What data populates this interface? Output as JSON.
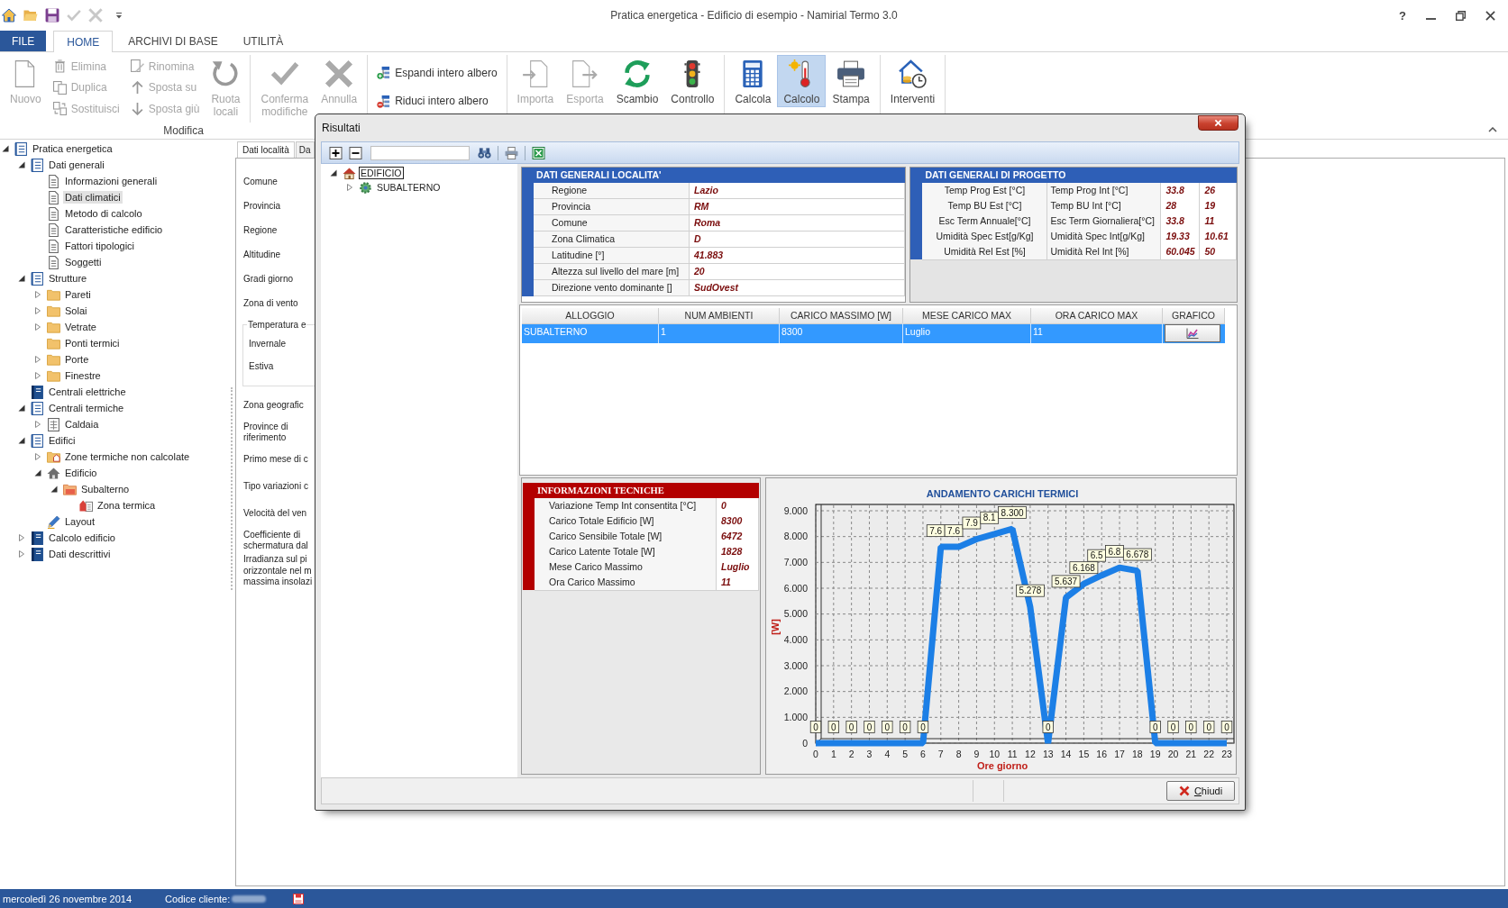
{
  "window": {
    "title": "Pratica energetica - Edificio di esempio - Namirial Termo 3.0",
    "help": "?"
  },
  "ribbon": {
    "tabs": [
      {
        "label": "FILE",
        "kind": "file",
        "selected": false
      },
      {
        "label": "HOME",
        "kind": "tab",
        "selected": true
      },
      {
        "label": "ARCHIVI DI BASE",
        "kind": "tab",
        "selected": false
      },
      {
        "label": "UTILITÀ",
        "kind": "tab",
        "selected": false
      }
    ],
    "groups": [
      {
        "label": "Modifica",
        "sections": [
          [
            {
              "kind": "large",
              "label": "Nuovo",
              "disabled": true,
              "pressed": false
            },
            {
              "kind": "stack",
              "items": [
                {
                  "label": "Elimina",
                  "disabled": true
                },
                {
                  "label": "Duplica",
                  "disabled": true
                },
                {
                  "label": "Sostituisci",
                  "disabled": true
                }
              ]
            },
            {
              "kind": "stack",
              "items": [
                {
                  "label": "Rinomina",
                  "disabled": true
                },
                {
                  "label": "Sposta su",
                  "disabled": true
                },
                {
                  "label": "Sposta giù",
                  "disabled": true
                }
              ]
            },
            {
              "kind": "large",
              "label": "Ruota locali",
              "disabled": true,
              "pressed": false
            }
          ],
          [
            {
              "kind": "large",
              "label": "Conferma modifiche",
              "disabled": true,
              "pressed": false
            },
            {
              "kind": "large",
              "label": "Annulla",
              "disabled": true,
              "pressed": false
            }
          ]
        ]
      },
      {
        "sections": [
          [
            {
              "kind": "stack",
              "items": [
                {
                  "label": "Espandi intero albero",
                  "disabled": false
                },
                {
                  "label": "Riduci intero albero",
                  "disabled": false
                }
              ]
            }
          ]
        ]
      },
      {
        "sections": [
          [
            {
              "kind": "large",
              "label": "Importa",
              "disabled": true,
              "pressed": false
            },
            {
              "kind": "large",
              "label": "Esporta",
              "disabled": true,
              "pressed": false
            },
            {
              "kind": "large",
              "label": "Scambio",
              "disabled": false,
              "pressed": false
            },
            {
              "kind": "large",
              "label": "Controllo",
              "disabled": false,
              "pressed": false
            }
          ]
        ]
      },
      {
        "sections": [
          [
            {
              "kind": "large",
              "label": "Calcola",
              "disabled": false,
              "pressed": false
            },
            {
              "kind": "large",
              "label": "Calcolo",
              "disabled": false,
              "pressed": true
            },
            {
              "kind": "large",
              "label": "Stampa",
              "disabled": false,
              "pressed": false
            }
          ]
        ]
      },
      {
        "sections": [
          [
            {
              "kind": "large",
              "label": "Interventi",
              "disabled": false,
              "pressed": false
            }
          ]
        ]
      }
    ]
  },
  "tree": [
    {
      "label": "Pratica energetica",
      "kind": "list",
      "expanded": true,
      "selected": false,
      "children": [
        {
          "label": "Dati generali",
          "kind": "list",
          "expanded": true,
          "selected": false,
          "children": [
            {
              "label": "Informazioni generali",
              "kind": "page",
              "selected": false
            },
            {
              "label": "Dati climatici",
              "kind": "page",
              "selected": true
            },
            {
              "label": "Metodo di calcolo",
              "kind": "page",
              "selected": false
            },
            {
              "label": "Caratteristiche edificio",
              "kind": "page",
              "selected": false
            },
            {
              "label": "Fattori tipologici",
              "kind": "page",
              "selected": false
            },
            {
              "label": "Soggetti",
              "kind": "page",
              "selected": false
            }
          ]
        },
        {
          "label": "Strutture",
          "kind": "list",
          "expanded": true,
          "selected": false,
          "children": [
            {
              "label": "Pareti",
              "kind": "folder",
              "expanded": false,
              "selected": false
            },
            {
              "label": "Solai",
              "kind": "folder",
              "expanded": false,
              "selected": false
            },
            {
              "label": "Vetrate",
              "kind": "folder",
              "expanded": false,
              "selected": false
            },
            {
              "label": "Ponti termici",
              "kind": "folder",
              "selected": false
            },
            {
              "label": "Porte",
              "kind": "folder",
              "expanded": false,
              "selected": false
            },
            {
              "label": "Finestre",
              "kind": "folder",
              "expanded": false,
              "selected": false
            }
          ]
        },
        {
          "label": "Centrali elettriche",
          "kind": "book",
          "selected": false
        },
        {
          "label": "Centrali termiche",
          "kind": "list",
          "expanded": true,
          "selected": false,
          "children": [
            {
              "label": "Caldaia",
              "kind": "unit",
              "expanded": false,
              "selected": false
            }
          ]
        },
        {
          "label": "Edifici",
          "kind": "list",
          "expanded": true,
          "selected": false,
          "children": [
            {
              "label": "Zone termiche non calcolate",
              "kind": "zonefolder",
              "expanded": false,
              "selected": false
            },
            {
              "label": "Edificio",
              "kind": "house",
              "expanded": true,
              "selected": false,
              "children": [
                {
                  "label": "Subalterno",
                  "kind": "subfolder",
                  "expanded": true,
                  "selected": false,
                  "children": [
                    {
                      "label": "Zona termica",
                      "kind": "zone",
                      "selected": false
                    }
                  ]
                }
              ]
            },
            {
              "label": "Layout",
              "kind": "pencil",
              "selected": false
            }
          ]
        },
        {
          "label": "Calcolo edificio",
          "kind": "book",
          "expanded": false,
          "selected": false
        },
        {
          "label": "Dati descrittivi",
          "kind": "book",
          "expanded": false,
          "selected": false
        }
      ]
    }
  ],
  "detail_panel": {
    "tabs": [
      {
        "label": "Dati località",
        "selected": true
      },
      {
        "label": "Da",
        "selected": false
      }
    ],
    "fields_top": [
      "Comune",
      "Provincia",
      "Regione",
      "Altitudine",
      "Gradi giorno",
      "Zona di vento"
    ],
    "group_box": {
      "title": "Temperatura e",
      "fields": [
        "Invernale",
        "Estiva"
      ]
    },
    "fields_bottom": [
      [
        "Zona geografic"
      ],
      [
        "Province di",
        "riferimento"
      ],
      [
        "Primo mese di c"
      ],
      [
        "Tipo variazioni c"
      ],
      [
        "Velocità del ven"
      ],
      [
        "Coefficiente di",
        "schermatura dal"
      ],
      [
        "Irradianza sul pi",
        "orizzontale nel m",
        "massima insolazi"
      ]
    ]
  },
  "dialog": {
    "title": "Risultati",
    "tree": [
      {
        "label": "EDIFICIO",
        "kind": "home",
        "expanded": true,
        "selected": true,
        "children": [
          {
            "label": "SUBALTERNO",
            "kind": "gear",
            "expanded": false,
            "selected": false
          }
        ]
      }
    ],
    "location": {
      "title": "DATI GENERALI LOCALITA'",
      "rows": [
        {
          "label": "Regione",
          "value": "Lazio"
        },
        {
          "label": "Provincia",
          "value": "RM"
        },
        {
          "label": "Comune",
          "value": "Roma"
        },
        {
          "label": "Zona Climatica",
          "value": "D"
        },
        {
          "label": "Latitudine [°]",
          "value": "41.883"
        },
        {
          "label": "Altezza sul livello del mare [m]",
          "value": "20"
        },
        {
          "label": "Direzione vento dominante []",
          "value": "SudOvest"
        }
      ]
    },
    "project": {
      "title": "DATI GENERALI DI PROGETTO",
      "rows": [
        {
          "label_1": "Temp Prog Est [°C]",
          "label_2": "Temp Prog Int [°C]",
          "value_1": "33.8",
          "value_2": "26"
        },
        {
          "label_1": "Temp BU Est [°C]",
          "label_2": "Temp BU Int [°C]",
          "value_1": "28",
          "value_2": "19"
        },
        {
          "label_1": "Esc Term Annuale[°C]",
          "label_2": "Esc Term Giornaliera[°C]",
          "value_1": "33.8",
          "value_2": "11"
        },
        {
          "label_1": "Umidità Spec Est[g/Kg]",
          "label_2": "Umidità Spec Int[g/Kg]",
          "value_1": "19.33",
          "value_2": "10.61"
        },
        {
          "label_1": "Umidità Rel Est [%]",
          "label_2": "Umidità Rel Int [%]",
          "value_1": "60.045",
          "value_2": "50"
        }
      ]
    },
    "results": {
      "columns": [
        "ALLOGGIO",
        "NUM AMBIENTI",
        "CARICO MASSIMO [W]",
        "MESE CARICO MAX",
        "ORA CARICO MAX",
        "GRAFICO"
      ],
      "rows": [
        {
          "selected": true,
          "cells": [
            "SUBALTERNO",
            "1",
            "8300",
            "Luglio",
            "11"
          ]
        }
      ]
    },
    "technical_info": {
      "title": "INFORMAZIONI TECNICHE",
      "rows": [
        {
          "label": "Variazione Temp Int consentita [°C]",
          "value": "0"
        },
        {
          "label": "Carico Totale Edificio [W]",
          "value": "8300"
        },
        {
          "label": "Carico Sensibile Totale [W]",
          "value": "6472"
        },
        {
          "label": "Carico Latente Totale [W]",
          "value": "1828"
        },
        {
          "label": "Mese Carico Massimo",
          "value": "Luglio"
        },
        {
          "label": "Ora Carico Massimo",
          "value": "11"
        }
      ]
    },
    "chart": {
      "chart_data": {
        "type": "line",
        "title": "ANDAMENTO CARICHI TERMICI",
        "xlabel": "Ore giorno",
        "ylabel": "[W]",
        "x": [
          0,
          1,
          2,
          3,
          4,
          5,
          6,
          7,
          8,
          9,
          10,
          11,
          12,
          13,
          14,
          15,
          16,
          17,
          18,
          19,
          20,
          21,
          22,
          23
        ],
        "values": [
          0,
          0,
          0,
          0,
          0,
          0,
          0,
          7.6,
          7.6,
          7.9,
          8.1,
          8.3,
          5.278,
          0,
          5.637,
          6.168,
          6.5,
          6.8,
          6.678,
          0,
          0,
          0,
          0,
          0
        ],
        "xlim": [
          0,
          23
        ],
        "ylim": [
          0,
          9
        ],
        "xticks": [
          0,
          1,
          2,
          3,
          4,
          5,
          6,
          7,
          8,
          9,
          10,
          11,
          12,
          13,
          14,
          15,
          16,
          17,
          18,
          19,
          20,
          21,
          22,
          23
        ],
        "yticks": [
          {
            "value": 0,
            "label": "0"
          },
          {
            "value": 1,
            "label": "1.000"
          },
          {
            "value": 2,
            "label": "2.000"
          },
          {
            "value": 3,
            "label": "3.000"
          },
          {
            "value": 4,
            "label": "4.000"
          },
          {
            "value": 5,
            "label": "5.000"
          },
          {
            "value": 6,
            "label": "6.000"
          },
          {
            "value": 7,
            "label": "7.000"
          },
          {
            "value": 8,
            "label": "8.000"
          },
          {
            "value": 9,
            "label": "9.000"
          }
        ],
        "grid": true,
        "value_labels": [
          "0",
          "0",
          "0",
          "0",
          "0",
          "0",
          "0",
          "7.6",
          "7.6",
          "7.9",
          "8.1",
          "8.300",
          "5.278",
          "0",
          "5.637",
          "6.168",
          "6.5",
          "6.8",
          "6.678",
          "0",
          "0",
          "0",
          "0",
          "0"
        ]
      }
    },
    "buttons": [
      {
        "label": "Chiudi"
      }
    ]
  },
  "status_bar": {
    "date": "mercoledì 26 novembre 2014",
    "client_label": "Codice cliente:"
  }
}
